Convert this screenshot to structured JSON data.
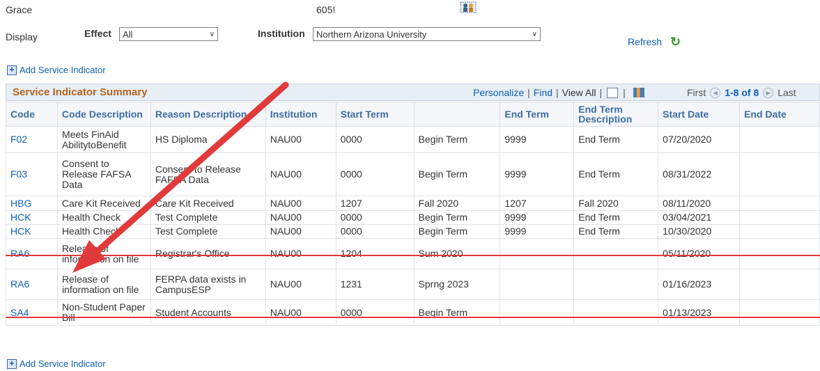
{
  "top": {
    "name": "Grace",
    "id": "605!"
  },
  "filters": {
    "display_label": "Display",
    "effect_label": "Effect",
    "effect_value": "All",
    "institution_label": "Institution",
    "institution_value": "Northern Arizona University",
    "refresh_label": "Refresh"
  },
  "add_label": "Add Service Indicator",
  "grid": {
    "title": "Service Indicator Summary",
    "personalize": "Personalize",
    "find": "Find",
    "view_all": "View All",
    "first": "First",
    "range": "1-8 of 8",
    "last": "Last",
    "columns": [
      "Code",
      "Code Description",
      "Reason Description",
      "Institution",
      "Start Term",
      "",
      "End Term",
      "End Term Description",
      "Start Date",
      "End Date"
    ],
    "rows": [
      {
        "code": "F02",
        "code_desc": "Meets FinAid AbilitytoBenefit",
        "reason": "HS Diploma",
        "inst": "NAU00",
        "start_term": "0000",
        "start_term_desc": "Begin Term",
        "end_term": "9999",
        "end_term_desc": "End Term",
        "start_date": "07/20/2020",
        "end_date": ""
      },
      {
        "code": "F03",
        "code_desc": "Consent to Release FAFSA Data",
        "reason": "Consent to Release FAFSA Data",
        "inst": "NAU00",
        "start_term": "0000",
        "start_term_desc": "Begin Term",
        "end_term": "9999",
        "end_term_desc": "End Term",
        "start_date": "08/31/2022",
        "end_date": ""
      },
      {
        "code": "HBG",
        "code_desc": "Care Kit Received",
        "reason": "Care Kit Received",
        "inst": "NAU00",
        "start_term": "1207",
        "start_term_desc": "Fall 2020",
        "end_term": "1207",
        "end_term_desc": "Fall 2020",
        "start_date": "08/11/2020",
        "end_date": ""
      },
      {
        "code": "HCK",
        "code_desc": "Health Check",
        "reason": "Test Complete",
        "inst": "NAU00",
        "start_term": "0000",
        "start_term_desc": "Begin Term",
        "end_term": "9999",
        "end_term_desc": "End Term",
        "start_date": "03/04/2021",
        "end_date": ""
      },
      {
        "code": "HCK",
        "code_desc": "Health Check",
        "reason": "Test Complete",
        "inst": "NAU00",
        "start_term": "0000",
        "start_term_desc": "Begin Term",
        "end_term": "9999",
        "end_term_desc": "End Term",
        "start_date": "10/30/2020",
        "end_date": ""
      },
      {
        "code": "RA6",
        "code_desc": "Release of information on file",
        "reason": "Registrar's Office",
        "inst": "NAU00",
        "start_term": "1204",
        "start_term_desc": "Sum 2020",
        "end_term": "",
        "end_term_desc": "",
        "start_date": "05/11/2020",
        "end_date": ""
      },
      {
        "code": "RA6",
        "code_desc": "Release of information on file",
        "reason": "FERPA data exists in CampusESP",
        "inst": "NAU00",
        "start_term": "1231",
        "start_term_desc": "Sprng 2023",
        "end_term": "",
        "end_term_desc": "",
        "start_date": "01/16/2023",
        "end_date": ""
      },
      {
        "code": "SA4",
        "code_desc": "Non-Student Paper Bill",
        "reason": "Student Accounts",
        "inst": "NAU00",
        "start_term": "0000",
        "start_term_desc": "Begin Term",
        "end_term": "",
        "end_term_desc": "",
        "start_date": "01/13/2023",
        "end_date": ""
      }
    ]
  },
  "colors": {
    "link": "#0e5fb5",
    "title": "#b5651d",
    "annotation": "#e13a3a"
  }
}
